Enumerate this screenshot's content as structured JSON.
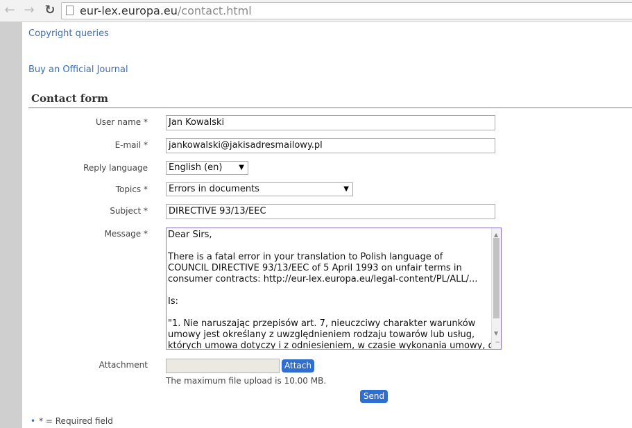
{
  "browser": {
    "url_domain": "eur-lex.europa.eu",
    "url_path": "/contact.html"
  },
  "links": {
    "copyright": "Copyright queries",
    "official_journal": "Buy an Official Journal"
  },
  "form": {
    "title": "Contact form",
    "user_name": {
      "label": "User name *",
      "value": "Jan Kowalski"
    },
    "email": {
      "label": "E-mail *",
      "value": "jankowalski@jakisadresmailowy.pl"
    },
    "reply_language": {
      "label": "Reply language",
      "value": "English (en)"
    },
    "topics": {
      "label": "Topics *",
      "value": "Errors in documents"
    },
    "subject": {
      "label": "Subject *",
      "value": "DIRECTIVE 93/13/EEC"
    },
    "message": {
      "label": "Message *",
      "value": "Dear Sirs,\n\nThere is a fatal error in your translation to Polish language of\nCOUNCIL DIRECTIVE 93/13/EEC of 5 April 1993 on unfair terms in\nconsumer contracts: http://eur-lex.europa.eu/legal-content/PL/ALL/...\n\nIs:\n\n\"1. Nie naruszając przepisów art. 7, nieuczciwy charakter warunków\numowy jest określany z uwzględnieniem rodzaju towarów lub usług,\nktórych umowa dotyczy i z odniesieniem, w czasie wykonania umowy, do"
    },
    "attachment": {
      "label": "Attachment",
      "button": "Attach",
      "hint": "The maximum file upload is 10.00 MB."
    },
    "send_button": "Send",
    "required_note": "* = Required field"
  },
  "icons": [
    "back-arrow-icon",
    "forward-arrow-icon",
    "reload-icon",
    "page-icon",
    "dropdown-arrow-icon",
    "scroll-up-icon",
    "scroll-down-icon",
    "resize-grip-icon"
  ],
  "colors": {
    "link": "#3a6fb5",
    "button": "#2f6fd2",
    "rule": "#4a86c5",
    "sidebar": "#cfcfcf"
  }
}
